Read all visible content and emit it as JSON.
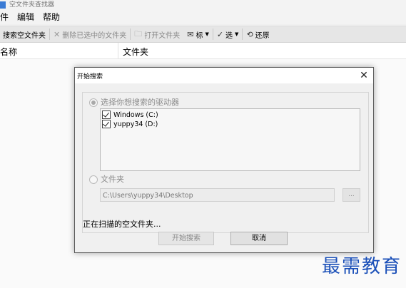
{
  "app": {
    "title": "空文件夹查找器"
  },
  "menu": {
    "items": [
      "件",
      "编辑",
      "帮助"
    ]
  },
  "toolbar": {
    "search_label": "搜索空文件夹",
    "delete_label": "删除已选中的文件夹",
    "open_label": "打开文件夹",
    "mark_label": "标",
    "select_label": "选",
    "restore_label": "还原"
  },
  "columns": {
    "name": "名称",
    "folder": "文件夹"
  },
  "dialog": {
    "title": "开始搜索",
    "close_glyph": "✕",
    "drives_option_label": "选择你想搜索的驱动器",
    "drives": [
      {
        "label": "Windows (C:)",
        "checked": true
      },
      {
        "label": "yuppy34 (D:)",
        "checked": true
      }
    ],
    "folder_option_label": "文件夹",
    "folder_path": "C:\\Users\\yuppy34\\Desktop",
    "browse_label": "...",
    "status": "正在扫描的空文件夹...",
    "start_button": "开始搜索",
    "cancel_button": "取消"
  },
  "watermark": "最需教育",
  "icons": {
    "delete": "close-x-icon",
    "open": "folder-open-icon",
    "mark": "mark-icon",
    "select": "checkmark-icon",
    "restore": "restore-icon"
  },
  "colors": {
    "watermark": "#1a4fb8",
    "app_icon": "#3a7bd5"
  }
}
